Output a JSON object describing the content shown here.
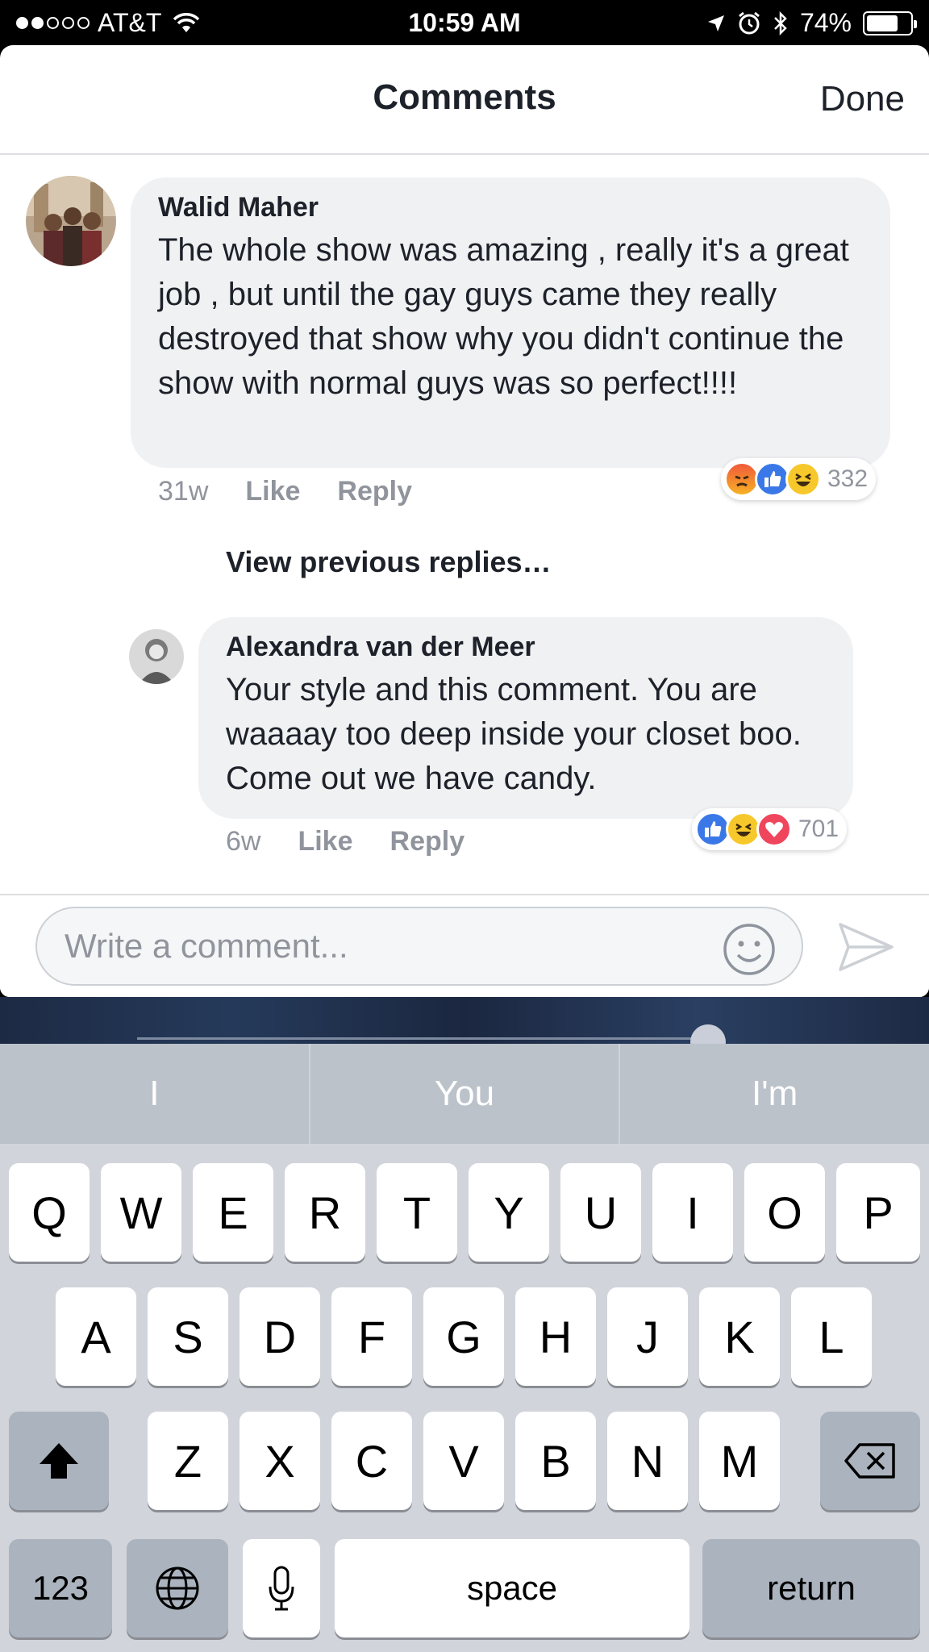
{
  "status_bar": {
    "carrier": "AT&T",
    "time": "10:59 AM",
    "battery": "74%",
    "battery_level": 0.74
  },
  "sheet": {
    "title": "Comments",
    "done_label": "Done"
  },
  "comments": [
    {
      "author": "Walid Maher",
      "text": "The whole show was amazing , really it's a great job , but until the gay guys came they really destroyed that show why you didn't continue the show with normal guys was so perfect!!!!",
      "age": "31w",
      "like_label": "Like",
      "reply_label": "Reply",
      "reaction_count": "332",
      "reactions": [
        "angry",
        "like",
        "haha"
      ]
    },
    {
      "author": "Alexandra van der Meer",
      "text": "Your style and this comment. You are waaaay too deep inside your closet boo. Come out we have candy.",
      "age": "6w",
      "like_label": "Like",
      "reply_label": "Reply",
      "reaction_count": "701",
      "reactions": [
        "like",
        "haha",
        "love"
      ]
    }
  ],
  "view_previous_label": "View previous replies…",
  "composer": {
    "placeholder": "Write a comment..."
  },
  "keyboard": {
    "predictions": [
      "I",
      "You",
      "I'm"
    ],
    "row1": [
      "Q",
      "W",
      "E",
      "R",
      "T",
      "Y",
      "U",
      "I",
      "O",
      "P"
    ],
    "row2": [
      "A",
      "S",
      "D",
      "F",
      "G",
      "H",
      "J",
      "K",
      "L"
    ],
    "row3": [
      "Z",
      "X",
      "C",
      "V",
      "B",
      "N",
      "M"
    ],
    "numbers_label": "123",
    "space_label": "space",
    "return_label": "return"
  },
  "colors": {
    "like_blue": "#3b78e7",
    "bubble_gray": "#f0f1f3",
    "meta_gray": "#90949c",
    "keyboard_bg": "#d1d5db"
  }
}
